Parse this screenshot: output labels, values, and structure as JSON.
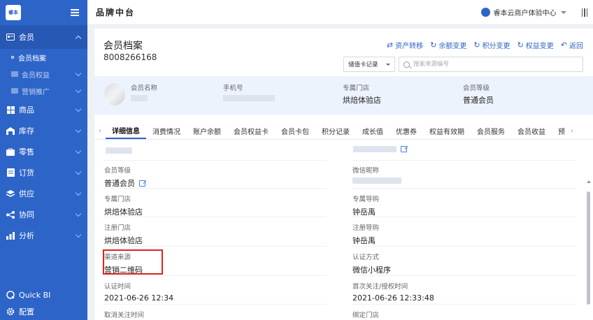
{
  "sidebar": {
    "logo_text": "睿本",
    "member_menu": {
      "label": "会员"
    },
    "member_submenu": [
      {
        "label": "会员档案"
      },
      {
        "label": "会员权益"
      },
      {
        "label": "营销推广"
      }
    ],
    "menu": [
      {
        "label": "商品"
      },
      {
        "label": "库存"
      },
      {
        "label": "零售"
      },
      {
        "label": "订货"
      },
      {
        "label": "供应"
      },
      {
        "label": "协同"
      },
      {
        "label": "分析"
      }
    ],
    "bottom": [
      {
        "label": "Quick BI"
      },
      {
        "label": "配置"
      }
    ]
  },
  "topbar": {
    "brand": "品牌中台",
    "org": "睿本云商户体验中心"
  },
  "page": {
    "title": "会员档案",
    "member_id": "8008266168",
    "actions": [
      {
        "label": "资产转移",
        "icon": "⇄"
      },
      {
        "label": "余额变更",
        "icon": "↻"
      },
      {
        "label": "积分变更",
        "icon": "↻"
      },
      {
        "label": "权益变更",
        "icon": "↻"
      },
      {
        "label": "返回",
        "icon": "↶"
      }
    ],
    "search_type": "储值卡记录",
    "search_placeholder": "搜索来源编号"
  },
  "summary": {
    "name_label": "会员名称",
    "phone_label": "手机号",
    "store_label": "专属门店",
    "store_value": "烘焙体验店",
    "level_label": "会员等级",
    "level_value": "普通会员"
  },
  "tabs": [
    "详细信息",
    "消费情况",
    "账户余额",
    "会员权益卡",
    "会员卡包",
    "积分记录",
    "成长值",
    "优惠券",
    "权益有效期",
    "会员服务",
    "会员收益",
    "预"
  ],
  "details": {
    "left": [
      {
        "label": "会员等级",
        "value": "普通会员"
      },
      {
        "label": "专属门店",
        "value": "烘焙体验店"
      },
      {
        "label": "注册门店",
        "value": "烘焙体验店"
      },
      {
        "label": "渠道来源",
        "value": "营销二维码"
      },
      {
        "label": "认证时间",
        "value": "2021-06-26 12:34"
      },
      {
        "label": "取消关注时间",
        "value": ""
      }
    ],
    "right": [
      {
        "label": "微信昵称",
        "value": ""
      },
      {
        "label": "专属导购",
        "value": "钟岳禹"
      },
      {
        "label": "注册导购",
        "value": "钟岳禹"
      },
      {
        "label": "认证方式",
        "value": "微信小程序"
      },
      {
        "label": "首次关注/授权时间",
        "value": "2021-06-26 12:33:48"
      },
      {
        "label": "绑定门店",
        "value": ""
      }
    ]
  }
}
